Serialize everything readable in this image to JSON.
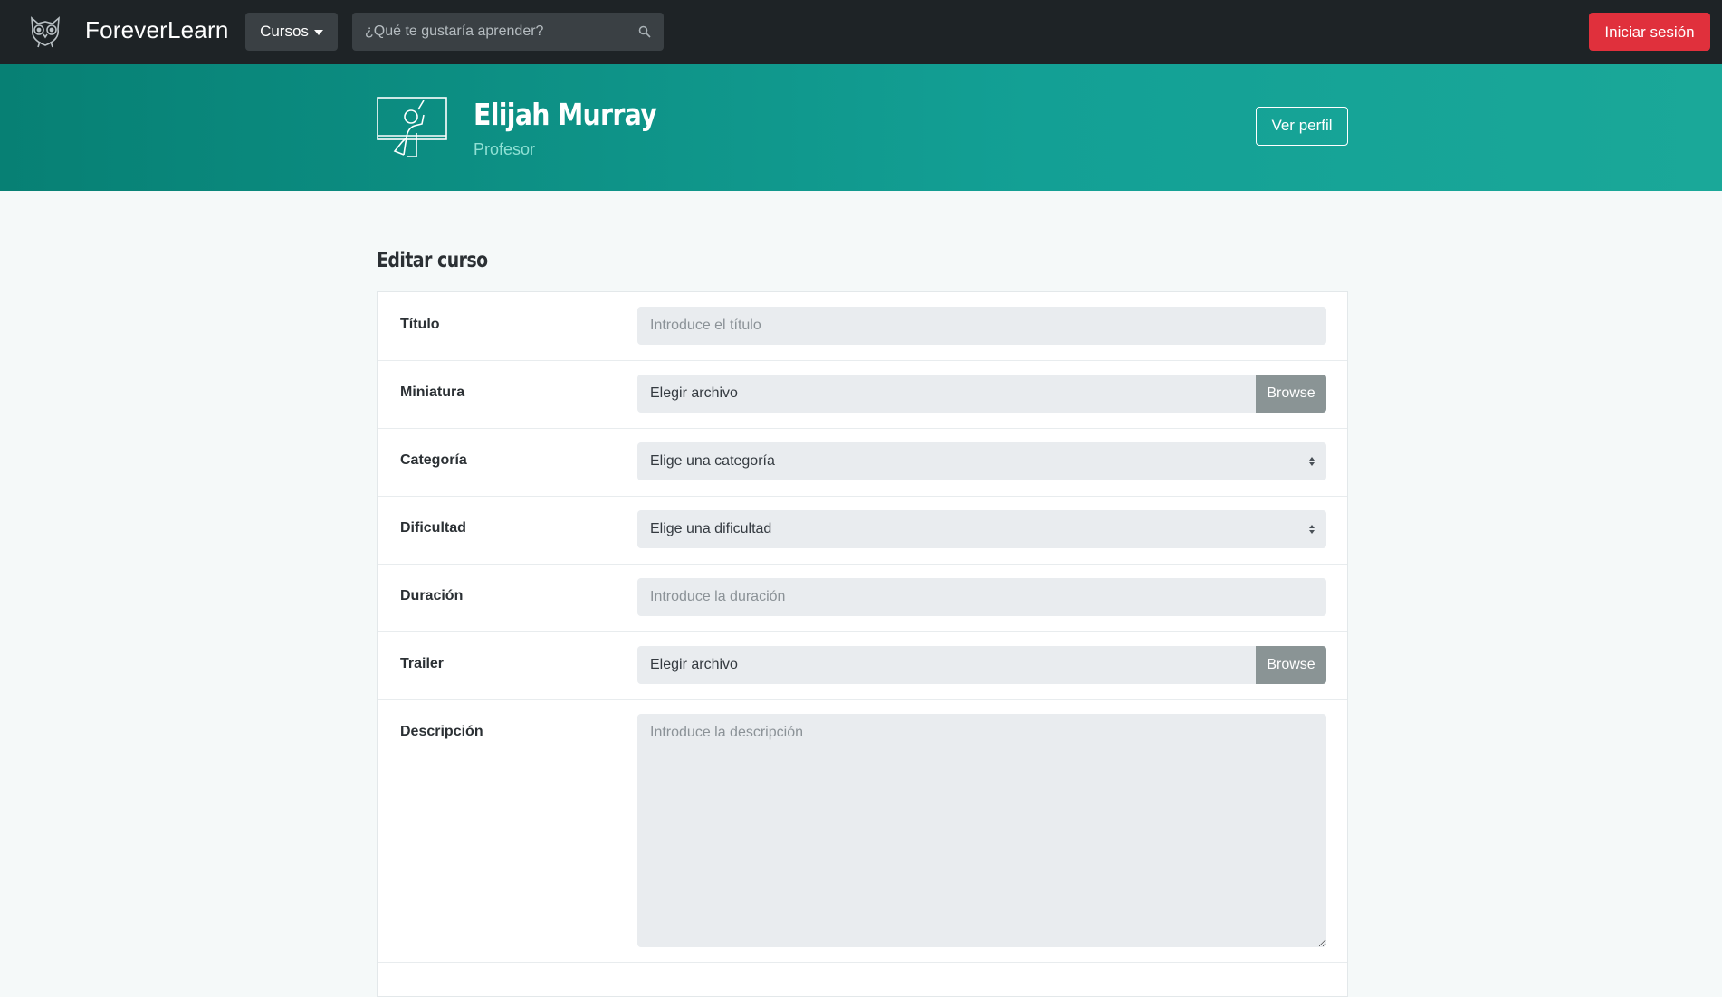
{
  "navbar": {
    "brand": "ForeverLearn",
    "courses_label": "Cursos",
    "search_placeholder": "¿Qué te gustaría aprender?",
    "login_label": "Iniciar sesión"
  },
  "hero": {
    "name": "Elijah Murray",
    "role": "Profesor",
    "profile_button": "Ver perfil"
  },
  "form": {
    "title": "Editar curso",
    "fields": {
      "title": {
        "label": "Título",
        "placeholder": "Introduce el título"
      },
      "thumbnail": {
        "label": "Miniatura",
        "value": "Elegir archivo",
        "button": "Browse"
      },
      "category": {
        "label": "Categoría",
        "value": "Elige una categoría"
      },
      "difficulty": {
        "label": "Dificultad",
        "value": "Elige una dificultad"
      },
      "duration": {
        "label": "Duración",
        "placeholder": "Introduce la duración"
      },
      "trailer": {
        "label": "Trailer",
        "value": "Elegir archivo",
        "button": "Browse"
      },
      "description": {
        "label": "Descripción",
        "placeholder": "Introduce la descripción"
      }
    }
  },
  "colors": {
    "navbar_bg": "#1e2326",
    "hero_start": "#078074",
    "hero_end": "#1aa899",
    "login_button": "#e0303c",
    "browse_button": "#8a9495"
  }
}
